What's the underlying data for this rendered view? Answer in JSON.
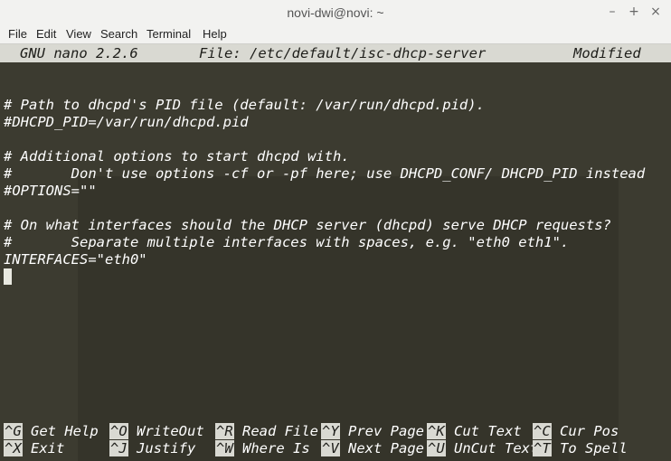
{
  "window": {
    "title": "novi-dwi@novi: ~",
    "controls": {
      "minimize": "–",
      "maximize": "+",
      "close": "×"
    }
  },
  "menu": [
    "File",
    "Edit",
    "View",
    "Search",
    "Terminal",
    "Help"
  ],
  "nano": {
    "version": "GNU nano 2.2.6",
    "file": "File: /etc/default/isc-dhcp-server",
    "status": "Modified"
  },
  "content_lines": [
    "# Path to dhcpd's PID file (default: /var/run/dhcpd.pid).",
    "#DHCPD_PID=/var/run/dhcpd.pid",
    "",
    "# Additional options to start dhcpd with.",
    "#       Don't use options -cf or -pf here; use DHCPD_CONF/ DHCPD_PID instead",
    "#OPTIONS=\"\"",
    "",
    "# On what interfaces should the DHCP server (dhcpd) serve DHCP requests?",
    "#       Separate multiple interfaces with spaces, e.g. \"eth0 eth1\".",
    "INTERFACES=\"eth0\""
  ],
  "shortcuts_row1": [
    {
      "key": "^G",
      "label": "Get Help"
    },
    {
      "key": "^O",
      "label": "WriteOut"
    },
    {
      "key": "^R",
      "label": "Read File"
    },
    {
      "key": "^Y",
      "label": "Prev Page"
    },
    {
      "key": "^K",
      "label": "Cut Text"
    },
    {
      "key": "^C",
      "label": "Cur Pos"
    }
  ],
  "shortcuts_row2": [
    {
      "key": "^X",
      "label": "Exit"
    },
    {
      "key": "^J",
      "label": "Justify"
    },
    {
      "key": "^W",
      "label": "Where Is"
    },
    {
      "key": "^V",
      "label": "Next Page"
    },
    {
      "key": "^U",
      "label": "UnCut Text"
    },
    {
      "key": "^T",
      "label": "To Spell"
    }
  ],
  "colors": {
    "terminal_bg": "#3c3b30",
    "bar_bg": "#d9d9d2",
    "text": "#ffffff"
  }
}
